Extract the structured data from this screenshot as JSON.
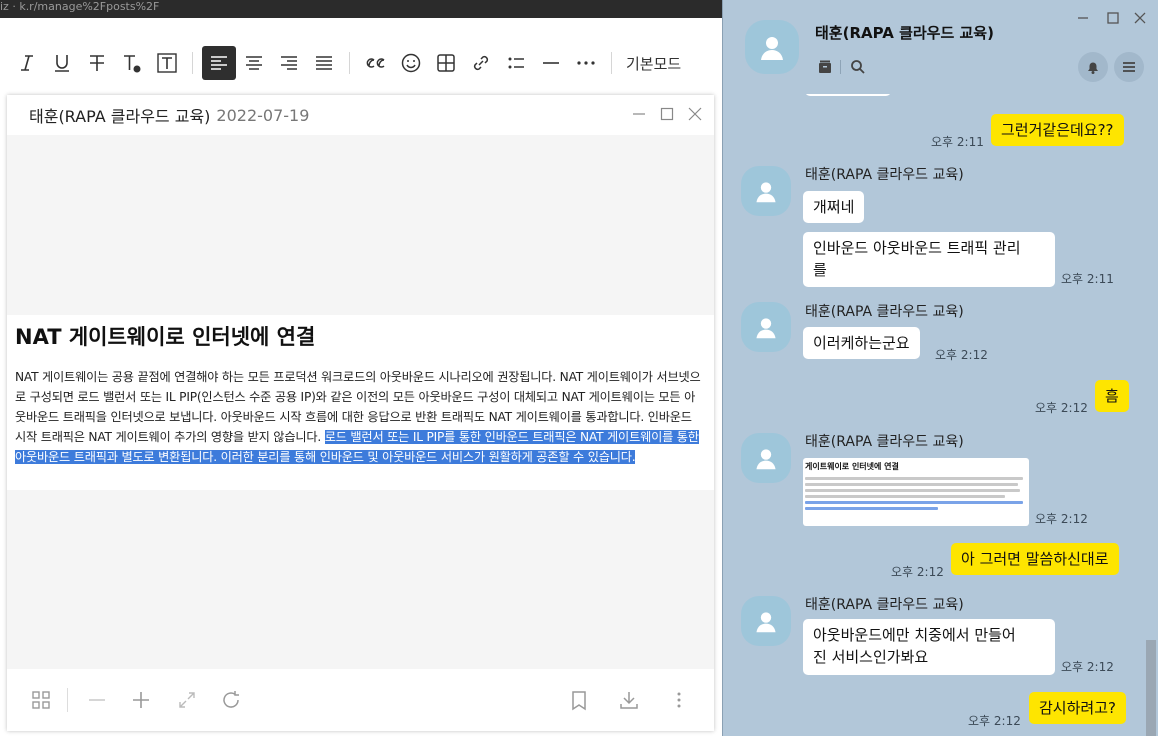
{
  "browser": {
    "url_fragment": "iz · k.r/manage%2Fposts%2F"
  },
  "toolbar": {
    "mode_label": "기본모드"
  },
  "viewer": {
    "sender": "태훈(RAPA 클라우드 교육)",
    "date": "2022-07-19",
    "doc_title": "NAT 게이트웨이로 인터넷에 연결",
    "doc_text_plain": "NAT 게이트웨이는 공용 끝점에 연결해야 하는 모든 프로덕션 워크로드의 아웃바운드 시나리오에 권장됩니다. NAT 게이트웨이가 서브넷으로 구성되면 로드 밸런서 또는 IL PIP(인스턴스 수준 공용 IP)와 같은 이전의 모든 아웃바운드 구성이 대체되고 NAT 게이트웨이는 모든 아웃바운드 트래픽을 인터넷으로 보냅니다. 아웃바운드 시작 흐름에 대한 응답으로 반환 트래픽도 NAT 게이트웨이를 통과합니다. 인바운드 시작 트래픽은 NAT 게이트웨이 추가의 영향을 받지 않습니다. ",
    "doc_text_highlight": "로드 밸런서 또는 IL PIP를 통한 인바운드 트래픽은 NAT 게이트웨이를 통한 아웃바운드 트래픽과 별도로 변환됩니다. 이러한 분리를 통해 인바운드 및 아웃바운드 서비스가 원활하게 공존할 수 있습니다."
  },
  "chat": {
    "title": "태훈(RAPA 클라우드 교육)",
    "messages": {
      "m1": {
        "text": "그런거같은데요??",
        "time": "오후 2:11"
      },
      "g1": {
        "sender": "태훈(RAPA 클라우드 교육)",
        "b1": "개쩌네",
        "b2": "인바운드 아웃바운드 트래픽 관리",
        "b2b": "를",
        "time": "오후 2:11"
      },
      "g2": {
        "sender": "태훈(RAPA 클라우드 교육)",
        "b1": "이러케하는군요",
        "time": "오후 2:12"
      },
      "m2": {
        "text": "흠",
        "time": "오후 2:12"
      },
      "g3": {
        "sender": "태훈(RAPA 클라우드 교육)",
        "thumb_title": "게이트웨이로 인터넷에 연결",
        "time": "오후 2:12"
      },
      "m3": {
        "text": "아 그러면 말씀하신대로",
        "time": "오후 2:12"
      },
      "g4": {
        "sender": "태훈(RAPA 클라우드 교육)",
        "b1": "아웃바운드에만 치중에서 만들어",
        "b1b": "진 서비스인가봐요",
        "time": "오후 2:12"
      },
      "m4": {
        "text": "감시하려고?",
        "time": "오후 2:12"
      }
    }
  }
}
